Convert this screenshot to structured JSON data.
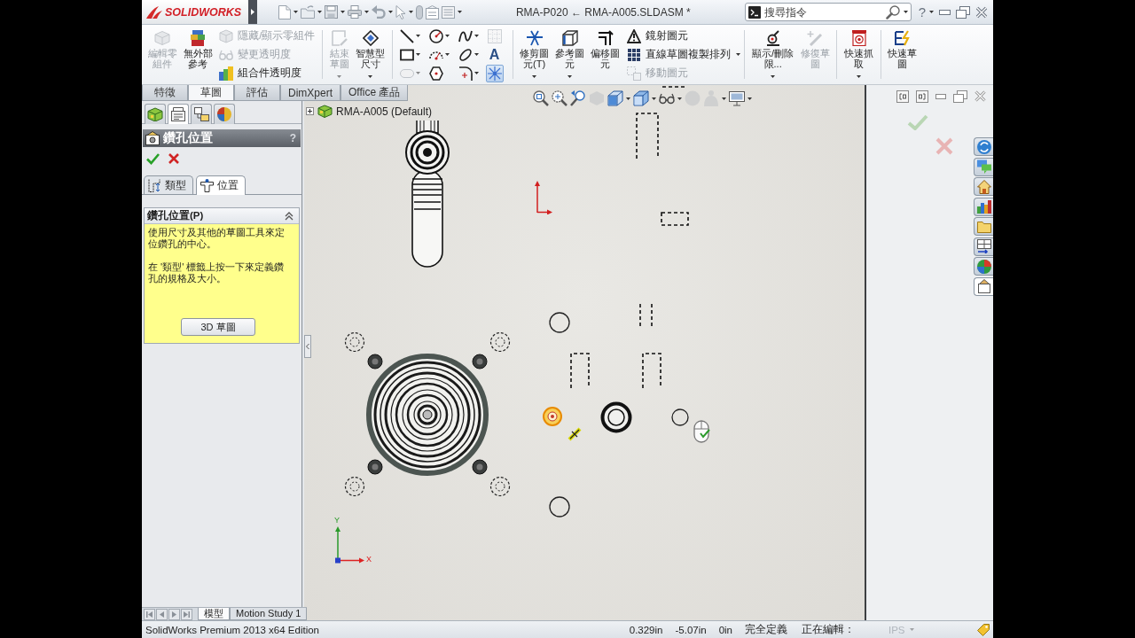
{
  "title_bar": {
    "logo": "SOLIDWORKS",
    "title": "RMA-P020 ← RMA-A005.SLDASM *",
    "search": {
      "placeholder": "搜尋指令"
    },
    "help": "?"
  },
  "ribbon": {
    "groups": [
      {
        "kind": "large",
        "items": [
          {
            "label": "編輯零組件",
            "disabled": true,
            "dropdown": false
          },
          {
            "label": "無外部參考",
            "disabled": false,
            "dropdown": false
          }
        ]
      },
      {
        "kind": "list",
        "items": [
          {
            "label": "隱藏/顯示零組件",
            "disabled": true
          },
          {
            "label": "變更透明度",
            "disabled": true
          },
          {
            "label": "組合件透明度",
            "disabled": false
          }
        ]
      },
      {
        "kind": "large",
        "items": [
          {
            "label": "結束草圖",
            "disabled": true,
            "dropdown": true
          },
          {
            "label": "智慧型尺寸",
            "disabled": false,
            "dropdown": true
          }
        ]
      },
      {
        "kind": "grid",
        "items": [
          {
            "selected": false,
            "disabled": false,
            "dropdown": true
          },
          {
            "selected": false,
            "disabled": false,
            "dropdown": true
          },
          {
            "selected": false,
            "disabled": false,
            "dropdown": true
          },
          {
            "selected": false,
            "disabled": true,
            "dropdown": false
          },
          {
            "selected": false,
            "disabled": false,
            "dropdown": true
          },
          {
            "selected": false,
            "disabled": false,
            "dropdown": true
          },
          {
            "selected": false,
            "disabled": false,
            "dropdown": true
          },
          {
            "label": "A",
            "selected": false,
            "disabled": false,
            "dropdown": false
          },
          {
            "selected": false,
            "disabled": true,
            "dropdown": true
          },
          {
            "selected": false,
            "disabled": false,
            "dropdown": false
          },
          {
            "selected": false,
            "disabled": false,
            "dropdown": true
          },
          {
            "selected": true,
            "disabled": false,
            "dropdown": false
          }
        ]
      },
      {
        "kind": "large",
        "items": [
          {
            "label": "修剪圖元(T)",
            "disabled": false,
            "dropdown": true
          },
          {
            "label": "參考圖元",
            "disabled": false,
            "dropdown": true
          },
          {
            "label": "偏移圖元",
            "disabled": false,
            "dropdown": false
          }
        ]
      },
      {
        "kind": "list",
        "dropdown": true,
        "items": [
          {
            "label": "鏡射圖元",
            "disabled": false
          },
          {
            "label": "直線草圖複製排列",
            "disabled": false
          },
          {
            "label": "移動圖元",
            "disabled": true
          }
        ]
      },
      {
        "kind": "large",
        "items": [
          {
            "label": "顯示/刪除限...",
            "disabled": false,
            "dropdown": true
          },
          {
            "label": "修復草圖",
            "disabled": true,
            "dropdown": false
          }
        ]
      },
      {
        "kind": "large",
        "items": [
          {
            "label": "快速抓取",
            "disabled": false,
            "dropdown": true
          }
        ]
      },
      {
        "kind": "large",
        "items": [
          {
            "label": "快速草圖",
            "disabled": false,
            "dropdown": false
          }
        ]
      }
    ]
  },
  "command_tabs": [
    {
      "label": "特徵",
      "selected": false
    },
    {
      "label": "草圖",
      "selected": true
    },
    {
      "label": "評估",
      "selected": false
    },
    {
      "label": "DimXpert",
      "selected": false
    },
    {
      "label": "Office 產品",
      "selected": false
    }
  ],
  "manager_tabs": [
    {
      "selected": false
    },
    {
      "selected": true
    },
    {
      "selected": false
    },
    {
      "selected": false
    }
  ],
  "property_manager": {
    "title": "鑽孔位置",
    "help": "?",
    "subtabs": [
      {
        "label": "類型",
        "selected": false
      },
      {
        "label": "位置",
        "selected": true
      }
    ],
    "group": {
      "title": "鑽孔位置(P)",
      "expanded": true,
      "messages": [
        "使用尺寸及其他的草圖工具來定位鑽孔的中心。",
        "在 '類型' 標籤上按一下來定義鑽孔的規格及大小。"
      ],
      "button": "3D 草圖"
    }
  },
  "canvas": {
    "tree_item": {
      "label": "RMA-A005 (Default)",
      "expanded": false
    },
    "origin": {
      "y_label": "Y",
      "x_label": "X"
    }
  },
  "task_pane": {
    "tabs": [
      {
        "selected": false
      },
      {
        "selected": false
      },
      {
        "selected": false
      },
      {
        "selected": false
      },
      {
        "selected": false
      },
      {
        "selected": false
      },
      {
        "selected": false
      },
      {
        "selected": true
      }
    ]
  },
  "bottom_tabs": [
    {
      "label": "模型",
      "selected": true
    },
    {
      "label": "Motion Study 1",
      "selected": false
    }
  ],
  "status_bar": {
    "edition": "SolidWorks Premium 2013 x64 Edition",
    "readouts": [
      "0.329in",
      "-5.07in",
      "0in"
    ],
    "sketch_status": "完全定義",
    "editing": "正在編輯：",
    "units": {
      "label": "IPS",
      "disabled": true
    }
  }
}
